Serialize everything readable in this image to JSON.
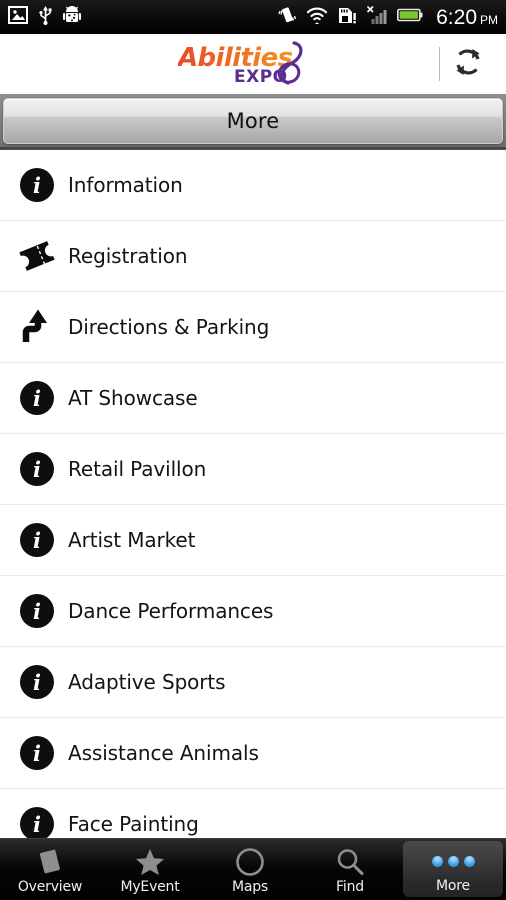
{
  "statusbar": {
    "left_icons": [
      {
        "name": "gallery-image-icon"
      },
      {
        "name": "usb-icon"
      },
      {
        "name": "android-robot-icon"
      }
    ],
    "right_icons": [
      {
        "name": "vibrate-icon"
      },
      {
        "name": "wifi-icon"
      },
      {
        "name": "sd-card-alert-icon"
      },
      {
        "name": "signal-no-service-icon"
      },
      {
        "name": "battery-icon"
      }
    ],
    "time": "6:20",
    "ampm": "PM"
  },
  "header": {
    "logo_primary": "Abilities",
    "logo_secondary": "EXPO",
    "refresh_label": "refresh-icon",
    "colors": {
      "orange_start": "#e8482a",
      "orange_end": "#f7941e",
      "purple": "#5b2d8e"
    }
  },
  "titlebar": {
    "title": "More"
  },
  "list": {
    "items": [
      {
        "label": "Information",
        "icon": "info-icon"
      },
      {
        "label": "Registration",
        "icon": "ticket-icon"
      },
      {
        "label": "Directions & Parking",
        "icon": "directions-arrow-icon"
      },
      {
        "label": "AT Showcase",
        "icon": "info-icon"
      },
      {
        "label": "Retail Pavillon",
        "icon": "info-icon"
      },
      {
        "label": "Artist Market",
        "icon": "info-icon"
      },
      {
        "label": "Dance Performances",
        "icon": "info-icon"
      },
      {
        "label": "Adaptive Sports",
        "icon": "info-icon"
      },
      {
        "label": "Assistance Animals",
        "icon": "info-icon"
      },
      {
        "label": "Face Painting",
        "icon": "info-icon"
      }
    ]
  },
  "tabbar": {
    "tabs": [
      {
        "label": "Overview",
        "icon": "page-tilted-icon",
        "active": false
      },
      {
        "label": "MyEvent",
        "icon": "star-icon",
        "active": false
      },
      {
        "label": "Maps",
        "icon": "compass-icon",
        "active": false
      },
      {
        "label": "Find",
        "icon": "search-icon",
        "active": false
      },
      {
        "label": "More",
        "icon": "three-dots-icon",
        "active": true
      }
    ],
    "active_color": "#4aa8e8"
  }
}
